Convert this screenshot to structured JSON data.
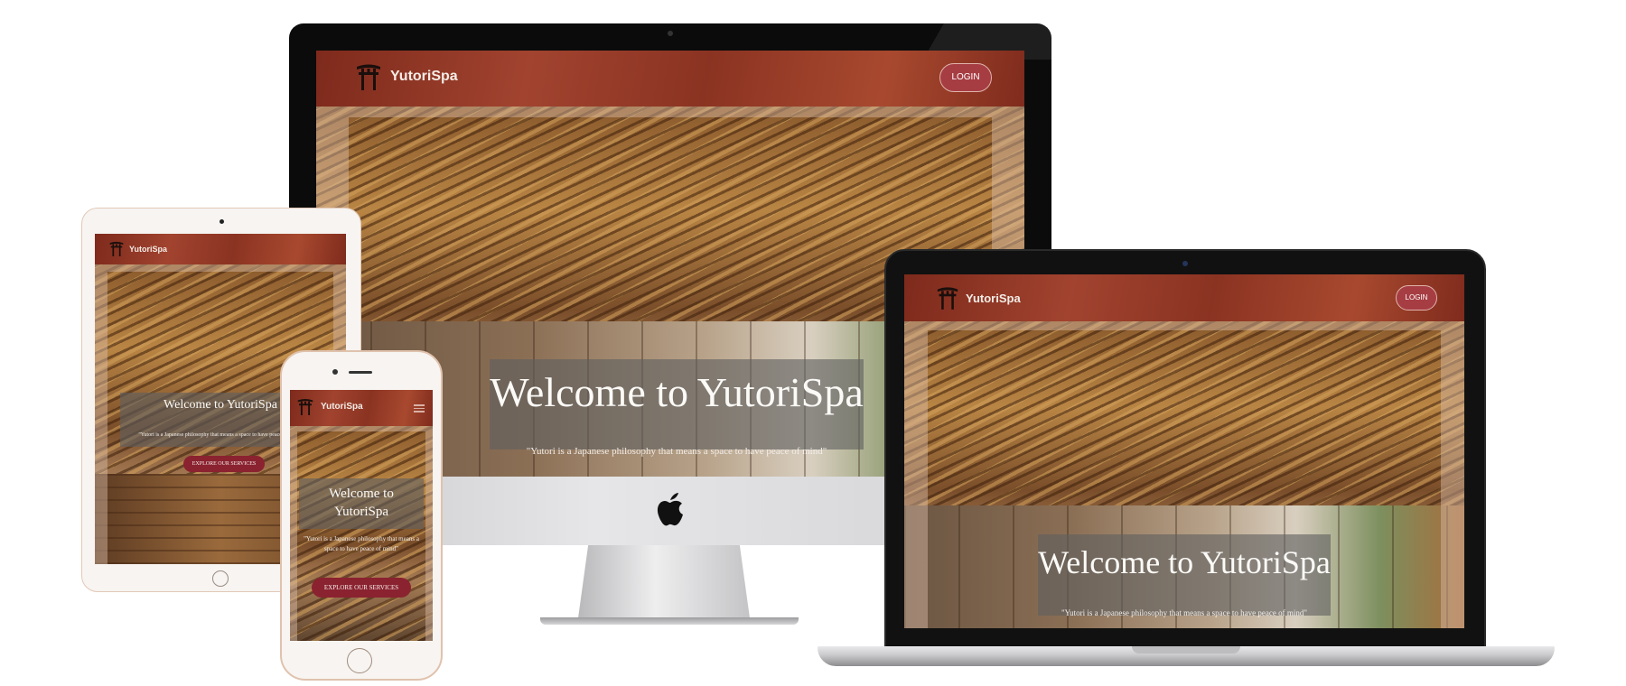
{
  "site": {
    "brand": "YutoriSpa",
    "login_label": "LOGIN",
    "hero_title": "Welcome to YutoriSpa",
    "hero_quote": "\"Yutori is a Japanese philosophy that means a space to have peace of mind\"",
    "cta_label": "EXPLORE OUR SERVICES"
  },
  "colors": {
    "navbar": "#8f3624",
    "login_button": "#a63d43",
    "cta_button": "#8a2230",
    "overlay": "#5f5f5f"
  },
  "icons": {
    "logo": "torii-gate-icon",
    "menu": "hamburger-menu-icon",
    "apple": "apple-logo-icon"
  }
}
